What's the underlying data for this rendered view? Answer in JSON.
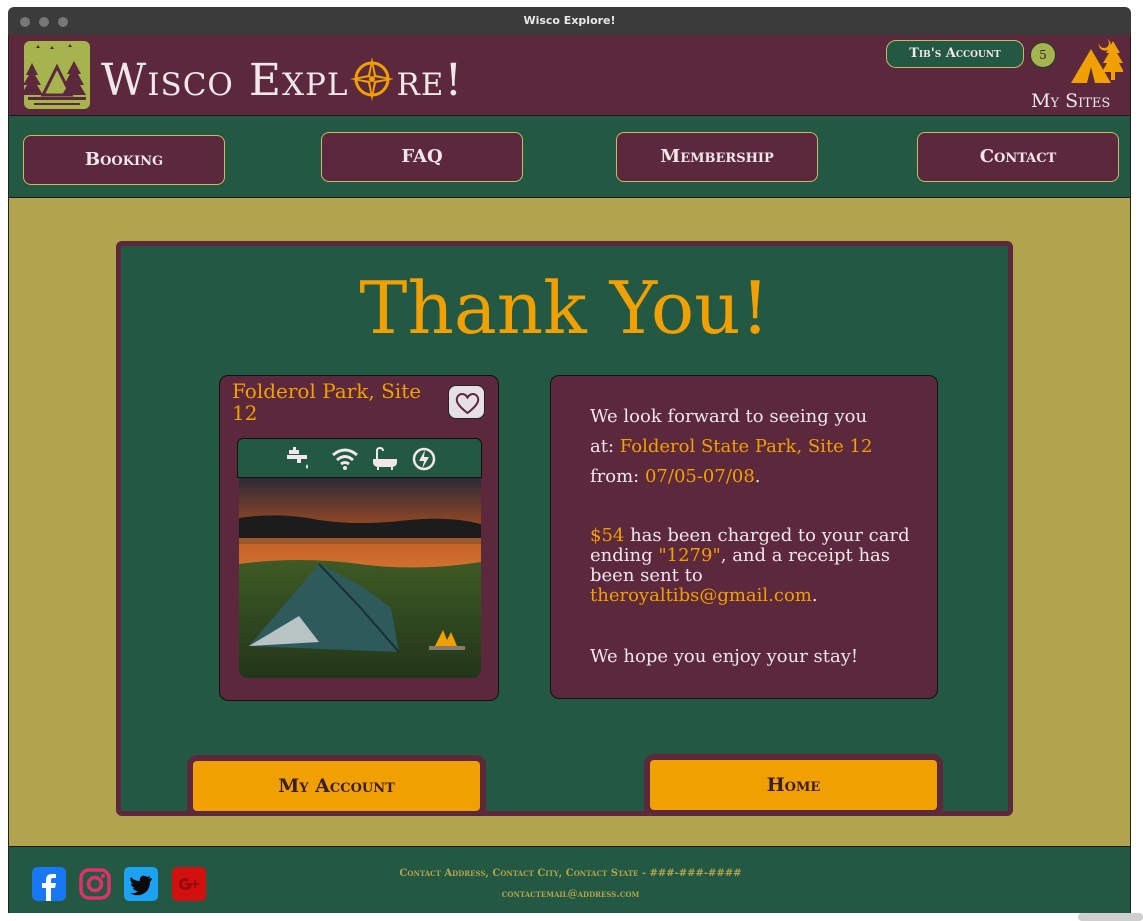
{
  "window": {
    "title": "Wisco Explore!"
  },
  "header": {
    "site_name_part1": "Wisco ",
    "site_name_part2_pre": "Expl",
    "site_name_part2_post": "re!",
    "account_label": "Tib's Account",
    "sites_count": "5",
    "my_sites_label": "My Sites"
  },
  "nav": {
    "items": [
      {
        "label": "Booking"
      },
      {
        "label": "FAQ"
      },
      {
        "label": "Membership"
      },
      {
        "label": "Contact"
      }
    ]
  },
  "main": {
    "heading": "Thank You!",
    "site_card": {
      "title": "Folderol Park, Site 12",
      "amenities": [
        "water-tap-icon",
        "wifi-icon",
        "bathtub-icon",
        "electric-hookup-icon"
      ]
    },
    "info": {
      "line1": "We look forward to seeing you",
      "line2_prefix": "at: ",
      "location": "Folderol State Park, Site 12",
      "line3_prefix": "from: ",
      "dates": "07/05-07/08",
      "period": ".",
      "amount": "$54",
      "charge_text_a": " has been charged to your card",
      "charge_text_b": "ending ",
      "card_ending": "\"1279\"",
      "charge_text_c": ", and a receipt has",
      "charge_text_d": "been sent to",
      "email": "theroyaltibs@gmail.com",
      "closing": "We hope you enjoy your stay!"
    },
    "buttons": {
      "account": "My Account",
      "home": "Home"
    }
  },
  "footer": {
    "address": "Contact Address, Contact City, Contact State - ###-###-####",
    "email": "contactemail@address.com",
    "social": [
      "facebook-icon",
      "instagram-icon",
      "twitter-icon",
      "google-plus-icon"
    ]
  },
  "colors": {
    "maroon": "#5b283c",
    "forest": "#235942",
    "olive": "#b2a34f",
    "orange": "#f0a000",
    "cream": "#f1e6ea"
  }
}
